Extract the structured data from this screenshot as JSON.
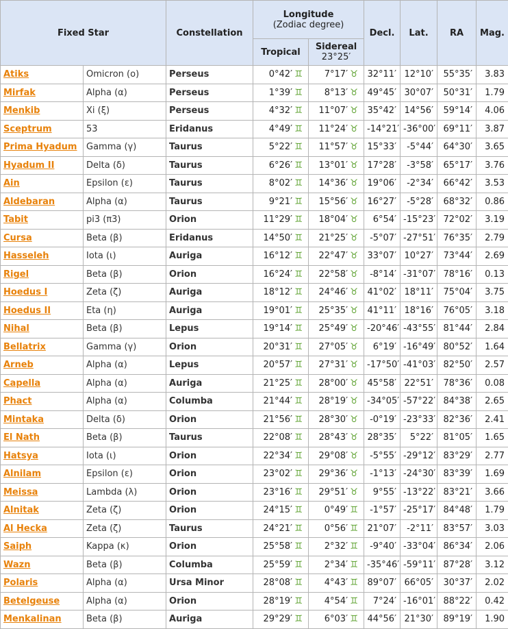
{
  "headers": {
    "fixed_star": "Fixed Star",
    "constellation": "Constellation",
    "longitude": "Longitude",
    "zodiac_degree": "(Zodiac degree)",
    "tropical": "Tropical",
    "sidereal": "Sidereal",
    "sidereal_offset": "23°25′",
    "decl": "Decl.",
    "lat": "Lat.",
    "ra": "RA",
    "mag": "Mag."
  },
  "signs": {
    "taurus": "♉",
    "gemini": "♊"
  },
  "rows": [
    {
      "name": "Atiks",
      "desig": "Omicron (ο)",
      "const": "Perseus",
      "trop": "0°42′",
      "trop_sign": "♊",
      "sid": "7°17′",
      "sid_sign": "♉",
      "decl": "32°11′",
      "lat": "12°10′",
      "ra": "55°35′",
      "mag": "3.83"
    },
    {
      "name": "Mirfak",
      "desig": "Alpha (α)",
      "const": "Perseus",
      "trop": "1°39′",
      "trop_sign": "♊",
      "sid": "8°13′",
      "sid_sign": "♉",
      "decl": "49°45′",
      "lat": "30°07′",
      "ra": "50°31′",
      "mag": "1.79"
    },
    {
      "name": "Menkib",
      "desig": "Xi (ξ)",
      "const": "Perseus",
      "trop": "4°32′",
      "trop_sign": "♊",
      "sid": "11°07′",
      "sid_sign": "♉",
      "decl": "35°42′",
      "lat": "14°56′",
      "ra": "59°14′",
      "mag": "4.06"
    },
    {
      "name": "Sceptrum",
      "desig": "53",
      "const": "Eridanus",
      "trop": "4°49′",
      "trop_sign": "♊",
      "sid": "11°24′",
      "sid_sign": "♉",
      "decl": "-14°21′",
      "lat": "-36°00′",
      "ra": "69°11′",
      "mag": "3.87"
    },
    {
      "name": "Prima Hyadum",
      "desig": "Gamma (γ)",
      "const": "Taurus",
      "trop": "5°22′",
      "trop_sign": "♊",
      "sid": "11°57′",
      "sid_sign": "♉",
      "decl": "15°33′",
      "lat": "-5°44′",
      "ra": "64°30′",
      "mag": "3.65"
    },
    {
      "name": "Hyadum II",
      "desig": "Delta (δ)",
      "const": "Taurus",
      "trop": "6°26′",
      "trop_sign": "♊",
      "sid": "13°01′",
      "sid_sign": "♉",
      "decl": "17°28′",
      "lat": "-3°58′",
      "ra": "65°17′",
      "mag": "3.76"
    },
    {
      "name": "Ain",
      "desig": "Epsilon (ε)",
      "const": "Taurus",
      "trop": "8°02′",
      "trop_sign": "♊",
      "sid": "14°36′",
      "sid_sign": "♉",
      "decl": "19°06′",
      "lat": "-2°34′",
      "ra": "66°42′",
      "mag": "3.53"
    },
    {
      "name": "Aldebaran",
      "desig": "Alpha (α)",
      "const": "Taurus",
      "trop": "9°21′",
      "trop_sign": "♊",
      "sid": "15°56′",
      "sid_sign": "♉",
      "decl": "16°27′",
      "lat": "-5°28′",
      "ra": "68°32′",
      "mag": "0.86"
    },
    {
      "name": "Tabit",
      "desig": "pi3 (π3)",
      "const": "Orion",
      "trop": "11°29′",
      "trop_sign": "♊",
      "sid": "18°04′",
      "sid_sign": "♉",
      "decl": "6°54′",
      "lat": "-15°23′",
      "ra": "72°02′",
      "mag": "3.19"
    },
    {
      "name": "Cursa",
      "desig": "Beta (β)",
      "const": "Eridanus",
      "trop": "14°50′",
      "trop_sign": "♊",
      "sid": "21°25′",
      "sid_sign": "♉",
      "decl": "-5°07′",
      "lat": "-27°51′",
      "ra": "76°35′",
      "mag": "2.79"
    },
    {
      "name": "Hasseleh",
      "desig": "Iota (ι)",
      "const": "Auriga",
      "trop": "16°12′",
      "trop_sign": "♊",
      "sid": "22°47′",
      "sid_sign": "♉",
      "decl": "33°07′",
      "lat": "10°27′",
      "ra": "73°44′",
      "mag": "2.69"
    },
    {
      "name": "Rigel",
      "desig": "Beta (β)",
      "const": "Orion",
      "trop": "16°24′",
      "trop_sign": "♊",
      "sid": "22°58′",
      "sid_sign": "♉",
      "decl": "-8°14′",
      "lat": "-31°07′",
      "ra": "78°16′",
      "mag": "0.13"
    },
    {
      "name": "Hoedus I",
      "desig": "Zeta (ζ)",
      "const": "Auriga",
      "trop": "18°12′",
      "trop_sign": "♊",
      "sid": "24°46′",
      "sid_sign": "♉",
      "decl": "41°02′",
      "lat": "18°11′",
      "ra": "75°04′",
      "mag": "3.75"
    },
    {
      "name": "Hoedus II",
      "desig": "Eta (η)",
      "const": "Auriga",
      "trop": "19°01′",
      "trop_sign": "♊",
      "sid": "25°35′",
      "sid_sign": "♉",
      "decl": "41°11′",
      "lat": "18°16′",
      "ra": "76°05′",
      "mag": "3.18"
    },
    {
      "name": "Nihal",
      "desig": "Beta (β)",
      "const": "Lepus",
      "trop": "19°14′",
      "trop_sign": "♊",
      "sid": "25°49′",
      "sid_sign": "♉",
      "decl": "-20°46′",
      "lat": "-43°55′",
      "ra": "81°44′",
      "mag": "2.84"
    },
    {
      "name": "Bellatrix",
      "desig": "Gamma (γ)",
      "const": "Orion",
      "trop": "20°31′",
      "trop_sign": "♊",
      "sid": "27°05′",
      "sid_sign": "♉",
      "decl": "6°19′",
      "lat": "-16°49′",
      "ra": "80°52′",
      "mag": "1.64"
    },
    {
      "name": "Arneb",
      "desig": "Alpha (α)",
      "const": "Lepus",
      "trop": "20°57′",
      "trop_sign": "♊",
      "sid": "27°31′",
      "sid_sign": "♉",
      "decl": "-17°50′",
      "lat": "-41°03′",
      "ra": "82°50′",
      "mag": "2.57"
    },
    {
      "name": "Capella",
      "desig": "Alpha (α)",
      "const": "Auriga",
      "trop": "21°25′",
      "trop_sign": "♊",
      "sid": "28°00′",
      "sid_sign": "♉",
      "decl": "45°58′",
      "lat": "22°51′",
      "ra": "78°36′",
      "mag": "0.08"
    },
    {
      "name": "Phact",
      "desig": "Alpha (α)",
      "const": "Columba",
      "trop": "21°44′",
      "trop_sign": "♊",
      "sid": "28°19′",
      "sid_sign": "♉",
      "decl": "-34°05′",
      "lat": "-57°22′",
      "ra": "84°38′",
      "mag": "2.65"
    },
    {
      "name": "Mintaka",
      "desig": "Delta (δ)",
      "const": "Orion",
      "trop": "21°56′",
      "trop_sign": "♊",
      "sid": "28°30′",
      "sid_sign": "♉",
      "decl": "-0°19′",
      "lat": "-23°33′",
      "ra": "82°36′",
      "mag": "2.41"
    },
    {
      "name": "El Nath",
      "desig": "Beta (β)",
      "const": "Taurus",
      "trop": "22°08′",
      "trop_sign": "♊",
      "sid": "28°43′",
      "sid_sign": "♉",
      "decl": "28°35′",
      "lat": "5°22′",
      "ra": "81°05′",
      "mag": "1.65"
    },
    {
      "name": "Hatsya",
      "desig": "Iota (ι)",
      "const": "Orion",
      "trop": "22°34′",
      "trop_sign": "♊",
      "sid": "29°08′",
      "sid_sign": "♉",
      "decl": "-5°55′",
      "lat": "-29°12′",
      "ra": "83°29′",
      "mag": "2.77"
    },
    {
      "name": "Alnilam",
      "desig": "Epsilon (ε)",
      "const": "Orion",
      "trop": "23°02′",
      "trop_sign": "♊",
      "sid": "29°36′",
      "sid_sign": "♉",
      "decl": "-1°13′",
      "lat": "-24°30′",
      "ra": "83°39′",
      "mag": "1.69"
    },
    {
      "name": "Meissa",
      "desig": "Lambda (λ)",
      "const": "Orion",
      "trop": "23°16′",
      "trop_sign": "♊",
      "sid": "29°51′",
      "sid_sign": "♉",
      "decl": "9°55′",
      "lat": "-13°22′",
      "ra": "83°21′",
      "mag": "3.66"
    },
    {
      "name": "Alnitak",
      "desig": "Zeta (ζ)",
      "const": "Orion",
      "trop": "24°15′",
      "trop_sign": "♊",
      "sid": "0°49′",
      "sid_sign": "♊",
      "decl": "-1°57′",
      "lat": "-25°17′",
      "ra": "84°48′",
      "mag": "1.79"
    },
    {
      "name": "Al Hecka",
      "desig": "Zeta (ζ)",
      "const": "Taurus",
      "trop": "24°21′",
      "trop_sign": "♊",
      "sid": "0°56′",
      "sid_sign": "♊",
      "decl": "21°07′",
      "lat": "-2°11′",
      "ra": "83°57′",
      "mag": "3.03"
    },
    {
      "name": "Saiph",
      "desig": "Kappa (κ)",
      "const": "Orion",
      "trop": "25°58′",
      "trop_sign": "♊",
      "sid": "2°32′",
      "sid_sign": "♊",
      "decl": "-9°40′",
      "lat": "-33°04′",
      "ra": "86°34′",
      "mag": "2.06"
    },
    {
      "name": "Wazn",
      "desig": "Beta (β)",
      "const": "Columba",
      "trop": "25°59′",
      "trop_sign": "♊",
      "sid": "2°34′",
      "sid_sign": "♊",
      "decl": "-35°46′",
      "lat": "-59°11′",
      "ra": "87°28′",
      "mag": "3.12"
    },
    {
      "name": "Polaris",
      "desig": "Alpha (α)",
      "const": "Ursa Minor",
      "trop": "28°08′",
      "trop_sign": "♊",
      "sid": "4°43′",
      "sid_sign": "♊",
      "decl": "89°07′",
      "lat": "66°05′",
      "ra": "30°37′",
      "mag": "2.02"
    },
    {
      "name": "Betelgeuse",
      "desig": "Alpha (α)",
      "const": "Orion",
      "trop": "28°19′",
      "trop_sign": "♊",
      "sid": "4°54′",
      "sid_sign": "♊",
      "decl": "7°24′",
      "lat": "-16°01′",
      "ra": "88°22′",
      "mag": "0.42"
    },
    {
      "name": "Menkalinan",
      "desig": "Beta (β)",
      "const": "Auriga",
      "trop": "29°29′",
      "trop_sign": "♊",
      "sid": "6°03′",
      "sid_sign": "♊",
      "decl": "44°56′",
      "lat": "21°30′",
      "ra": "89°19′",
      "mag": "1.90"
    }
  ]
}
